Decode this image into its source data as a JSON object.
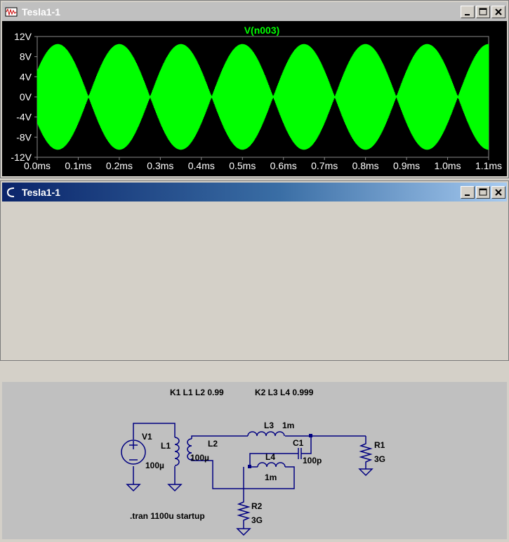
{
  "waveform_window": {
    "title": "Tesla1-1",
    "trace_label": "V(n003)",
    "y_ticks": [
      "12V",
      "8V",
      "4V",
      "0V",
      "-4V",
      "-8V",
      "-12V"
    ],
    "x_ticks": [
      "0.0ms",
      "0.1ms",
      "0.2ms",
      "0.3ms",
      "0.4ms",
      "0.5ms",
      "0.6ms",
      "0.7ms",
      "0.8ms",
      "0.9ms",
      "1.0ms",
      "1.1ms"
    ],
    "trace_color": "#00ff00",
    "label_color": "#00ff00"
  },
  "chart_data": {
    "type": "line",
    "title": "V(n003)",
    "xlabel": "",
    "ylabel": "",
    "x_unit": "ms",
    "y_unit": "V",
    "xlim": [
      0,
      1.1
    ],
    "ylim": [
      -12,
      12
    ],
    "grid": true,
    "series": [
      {
        "name": "V(n003)",
        "envelope_peak_times_ms": [
          0.05,
          0.2,
          0.35,
          0.5,
          0.65,
          0.8,
          0.95,
          1.1
        ],
        "envelope_null_times_ms": [
          0.0,
          0.13,
          0.28,
          0.43,
          0.58,
          0.73,
          0.88,
          1.03
        ],
        "peak_amplitude_V": 10.5
      }
    ]
  },
  "schematic_window": {
    "title": "Tesla1-1",
    "directives": {
      "k1": "K1 L1 L2 0.99",
      "k2": "K2 L3 L4 0.999",
      "tran": ".tran 1100u startup"
    },
    "components": {
      "v1": "V1",
      "l1": "L1",
      "l1_value": "100µ",
      "l2": "L2",
      "l2_value": "100µ",
      "l3": "L3",
      "l3_value": "1m",
      "l4": "L4",
      "l4_value": "1m",
      "c1": "C1",
      "c1_value": "100p",
      "r1": "R1",
      "r1_value": "3G",
      "r2": "R2",
      "r2_value": "3G"
    },
    "wire_color": "#000080",
    "label_color": "#000000"
  }
}
